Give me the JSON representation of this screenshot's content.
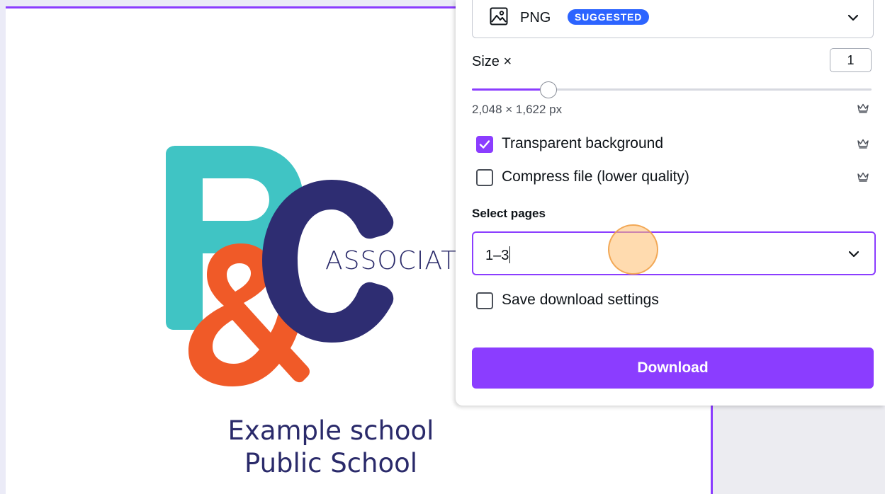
{
  "canvas": {
    "logo_text": "ASSOCIATIC",
    "school_line1": "Example school",
    "school_line2": "Public School",
    "logo_colors": {
      "teal": "#40c4c4",
      "orange": "#f05a28",
      "navy": "#2e2d72"
    }
  },
  "download_panel": {
    "file_type": {
      "icon": "image-icon",
      "label": "PNG",
      "badge": "SUGGESTED"
    },
    "size": {
      "label": "Size ×",
      "value": "1",
      "slider_fraction": 0.19
    },
    "dimensions": "2,048 × 1,622 px",
    "options": [
      {
        "label": "Transparent background",
        "checked": true,
        "premium": true
      },
      {
        "label": "Compress file (lower quality)",
        "checked": false,
        "premium": true
      }
    ],
    "select_pages": {
      "title": "Select pages",
      "value": "1–3"
    },
    "save_settings": {
      "label": "Save download settings",
      "checked": false
    },
    "download_label": "Download"
  },
  "colors": {
    "accent": "#8b3dff",
    "badge": "#2c64ff"
  }
}
